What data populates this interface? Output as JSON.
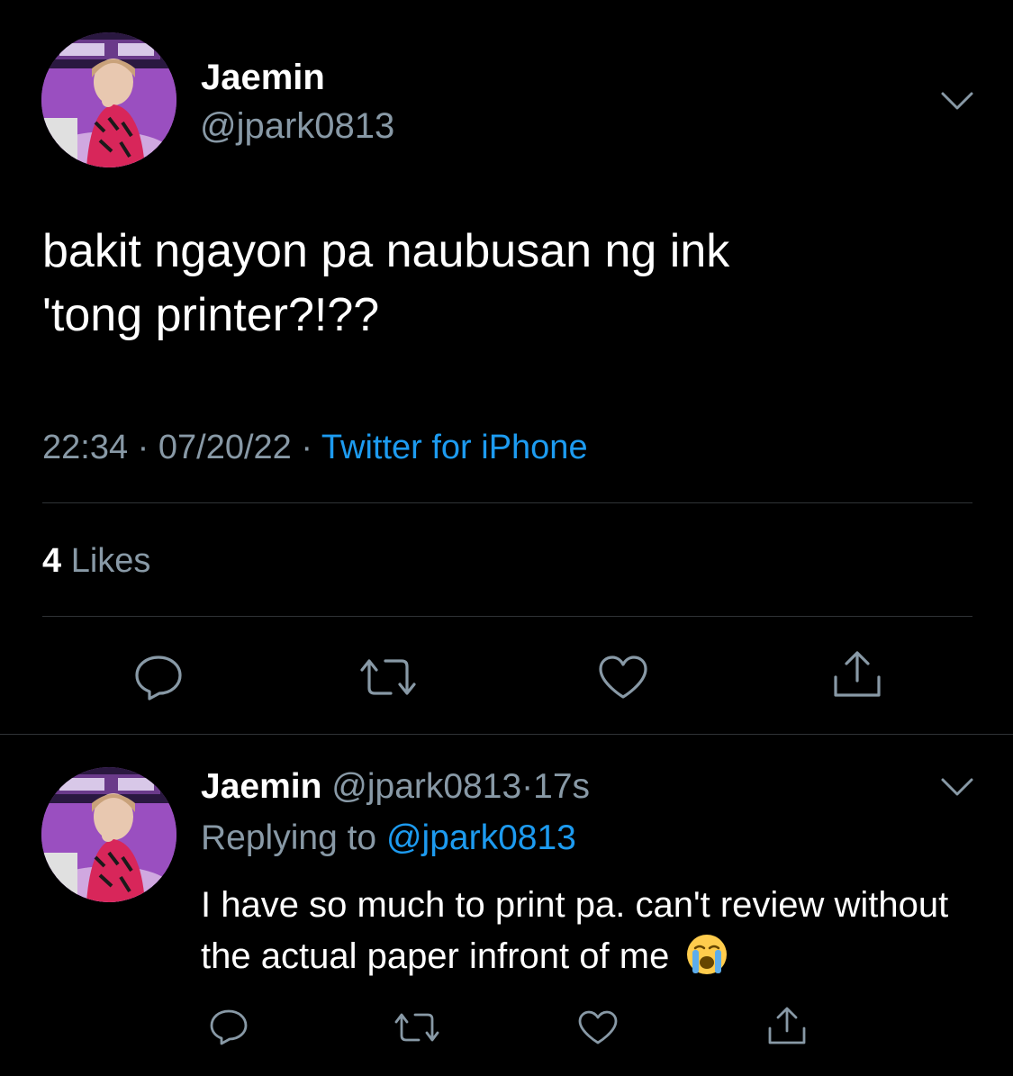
{
  "tweet": {
    "author_name": "Jaemin",
    "author_handle": "@jpark0813",
    "text": "bakit ngayon pa naubusan ng ink\n'tong printer?!??",
    "time": "22:34",
    "date": "07/20/22",
    "separator": "·",
    "source": "Twitter for iPhone",
    "likes_count": "4",
    "likes_label": "Likes"
  },
  "reply": {
    "author_name": "Jaemin",
    "author_handle": "@jpark0813",
    "separator": "·",
    "age": "17s",
    "replying_to_label": "Replying to",
    "replying_to_handle": "@jpark0813",
    "text": "I have so much to print pa. can't review without the actual paper infront of me",
    "emoji": "loudly-crying-face"
  },
  "icons": {
    "reply": "speech-bubble-icon",
    "retweet": "retweet-icon",
    "like": "heart-icon",
    "share": "share-icon",
    "menu": "chevron-down-icon"
  },
  "colors": {
    "background": "#000000",
    "primary_text": "#ffffff",
    "secondary_text": "#8899a6",
    "link": "#1d9bf0",
    "divider": "#2f3336"
  }
}
